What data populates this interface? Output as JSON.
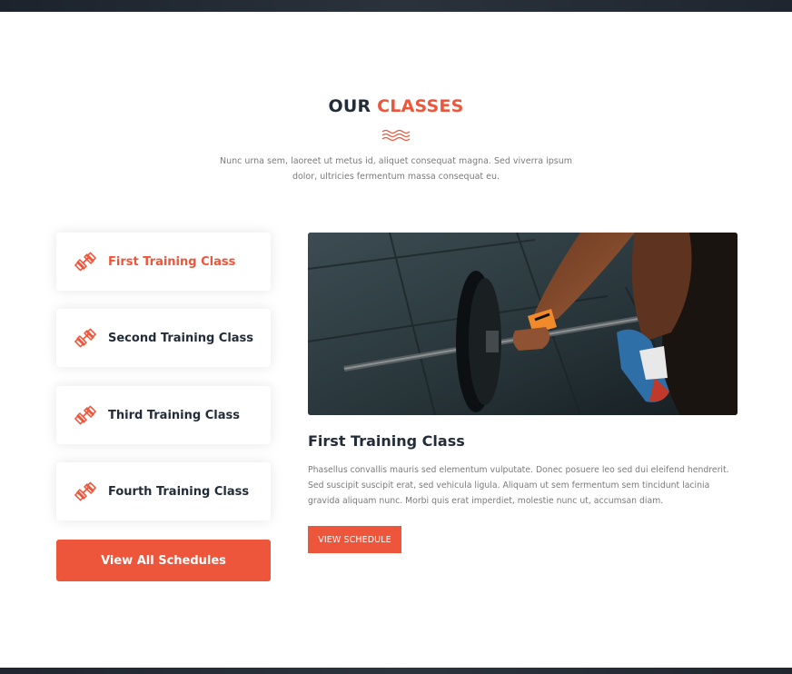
{
  "heading": {
    "part1": "OUR",
    "part2": "CLASSES"
  },
  "description": "Nunc urna sem, laoreet ut metus id, aliquet consequat magna. Sed viverra ipsum dolor, ultricies fermentum massa consequat eu.",
  "tabs": [
    {
      "label": "First Training Class",
      "icon": "dumbbell-icon",
      "active": true
    },
    {
      "label": "Second Training Class",
      "icon": "dumbbell-icon",
      "active": false
    },
    {
      "label": "Third Training Class",
      "icon": "dumbbell-icon",
      "active": false
    },
    {
      "label": "Fourth Training Class",
      "icon": "dumbbell-icon",
      "active": false
    }
  ],
  "all_button": "View All Schedules",
  "selected_class": {
    "title": "First Training Class",
    "text": "Phasellus convallis mauris sed elementum vulputate. Donec posuere leo sed dui eleifend hendrerit. Sed suscipit suscipit erat, sed vehicula ligula. Aliquam ut sem fermentum sem tincidunt lacinia gravida aliquam nunc. Morbi quis erat imperdiet, molestie nunc ut, accumsan diam.",
    "button": "VIEW SCHEDULE",
    "image": "barbell-deadlift-photo"
  },
  "colors": {
    "accent": "#ed563b",
    "dark": "#232d39",
    "muted": "#7a7a7a"
  }
}
